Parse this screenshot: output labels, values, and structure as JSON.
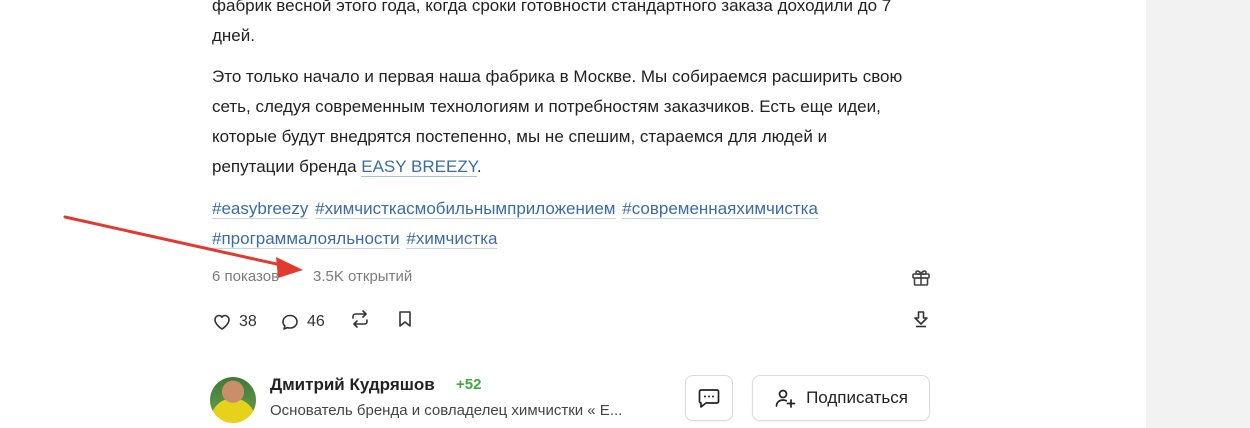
{
  "article": {
    "paragraph1": "фабрик весной этого года, когда сроки готовности стандартного заказа доходили до 7 дней.",
    "paragraph2_text": "Это только начало и первая наша фабрика в Москве. Мы собираемся расширить свою сеть, следуя современным технологиям и потребностям заказчиков. Есть еще идеи, которые будут внедрятся постепенно, мы не спешим, стараемся для людей и репутации бренда ",
    "brand_link": "EASY BREEZY",
    "paragraph2_end": ".",
    "tags": [
      "#easybreezy",
      "#химчисткасмобильнымприложением",
      "#современнаяхимчистка",
      "#программалояльности",
      "#химчистка"
    ]
  },
  "stats": {
    "views": "6 показов",
    "opens": "3.5K открытий",
    "gift_icon": "gift-icon"
  },
  "actions": {
    "likes": "38",
    "comments": "46",
    "repost_icon": "repost-icon",
    "bookmark_icon": "bookmark-icon",
    "download_icon": "download-icon"
  },
  "author": {
    "name": "Дмитрий Кудряшов",
    "karma": "+52",
    "description": "Основатель бренда и совладелец химчистки « E...",
    "message_icon": "message-icon",
    "subscribe_label": "Подписаться"
  },
  "colors": {
    "link": "#3a6ca8",
    "karma": "#3caa3c",
    "arrow": "#e03b2e",
    "side_panel": "#f2f2f2"
  }
}
